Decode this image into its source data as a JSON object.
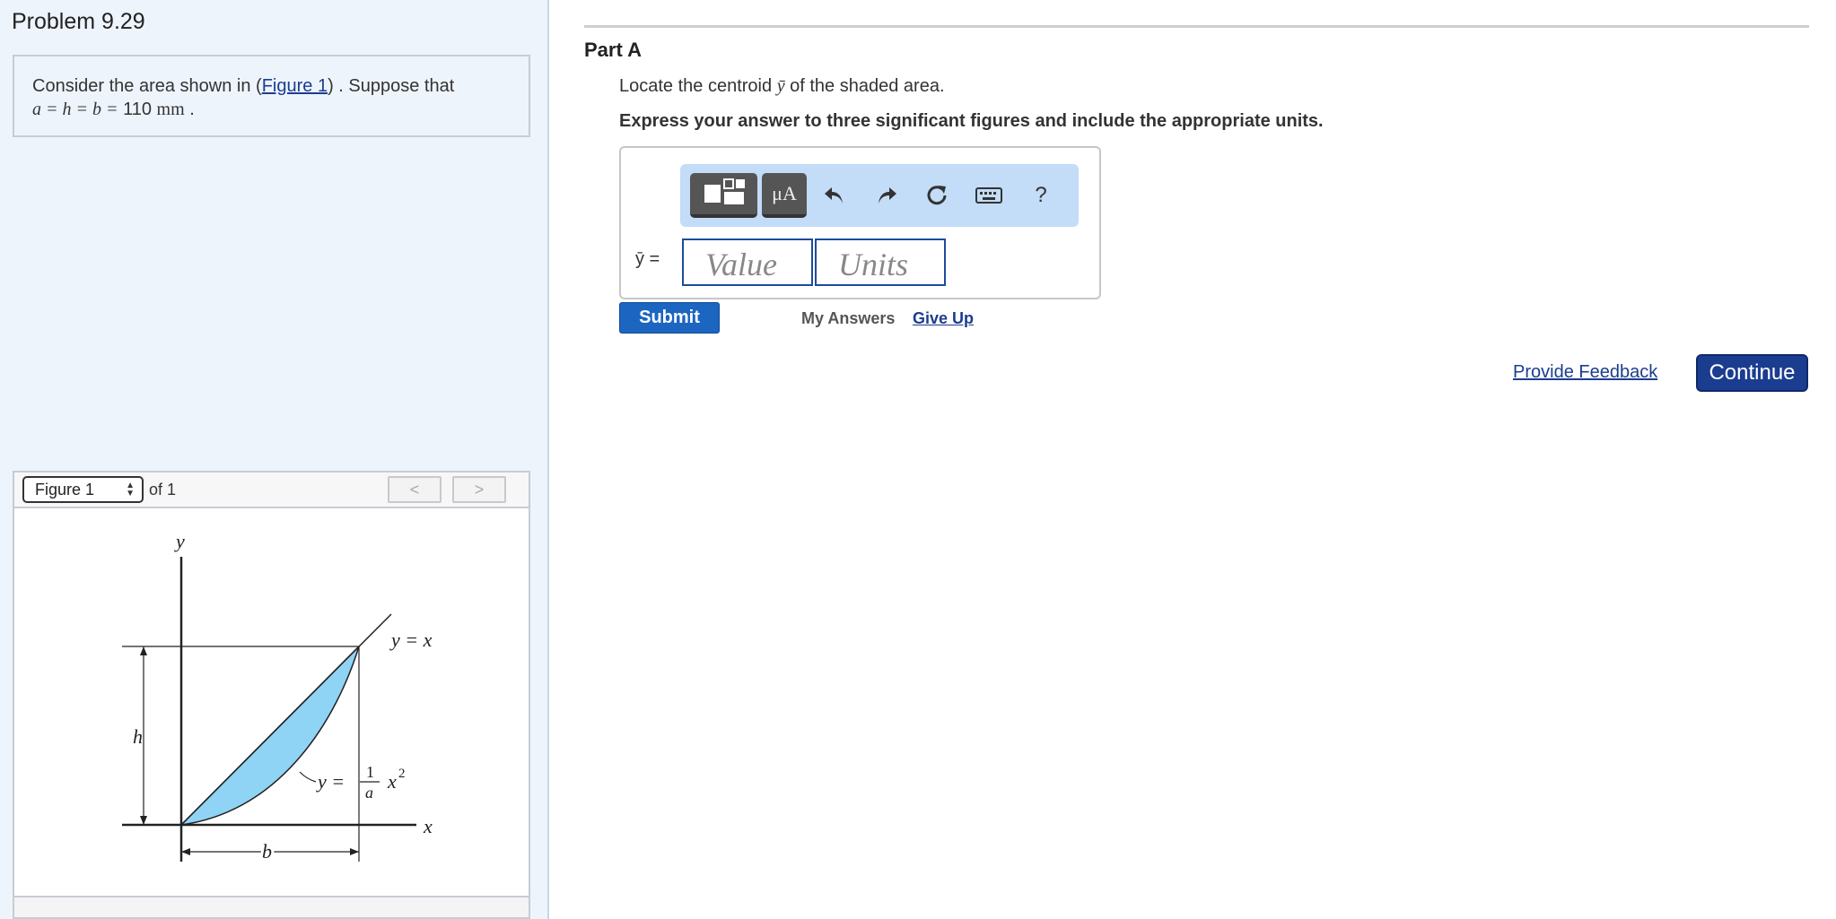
{
  "problem": {
    "title": "Problem 9.29",
    "statement_prefix": "Consider the area shown in (",
    "figure_link": "Figure 1",
    "statement_suffix": ") . Suppose that",
    "equation_lhs": "a = h = b =",
    "equation_value": "110",
    "equation_unit": "mm",
    "equation_end": "."
  },
  "figure": {
    "selected": "Figure 1",
    "of_text": "of 1",
    "prev_glyph": "<",
    "next_glyph": ">",
    "labels": {
      "y_axis": "y",
      "x_axis": "x",
      "line_eq": "y = x",
      "curve_eq_lhs": "y =",
      "curve_eq_num": "1",
      "curve_eq_den": "a",
      "curve_eq_rhs": "x",
      "curve_eq_exp": "2",
      "h": "h",
      "b": "b"
    },
    "colors": {
      "shaded": "#8fd3f5"
    }
  },
  "part": {
    "title": "Part A",
    "question_prefix": "Locate the centroid",
    "question_symbol": "ȳ",
    "question_suffix": "of the shaded area.",
    "instruction": "Express your answer to three significant figures and include the appropriate units."
  },
  "answer": {
    "toolbar": {
      "template_icon": "template-icon",
      "units_label": "μA",
      "undo_icon": "undo-icon",
      "redo_icon": "redo-icon",
      "reset_icon": "reset-icon",
      "keyboard_icon": "keyboard-icon",
      "help_label": "?"
    },
    "label": "ȳ =",
    "value_placeholder": "Value",
    "units_placeholder": "Units"
  },
  "actions": {
    "submit": "Submit",
    "my_answers": "My Answers",
    "give_up": "Give Up",
    "provide_feedback": "Provide Feedback",
    "continue": "Continue"
  },
  "colors": {
    "panel_bg": "#eef4fc",
    "primary": "#1c65c0",
    "continue_bg": "#1b3d8f",
    "toolbar_bg": "#c3dcf7"
  }
}
